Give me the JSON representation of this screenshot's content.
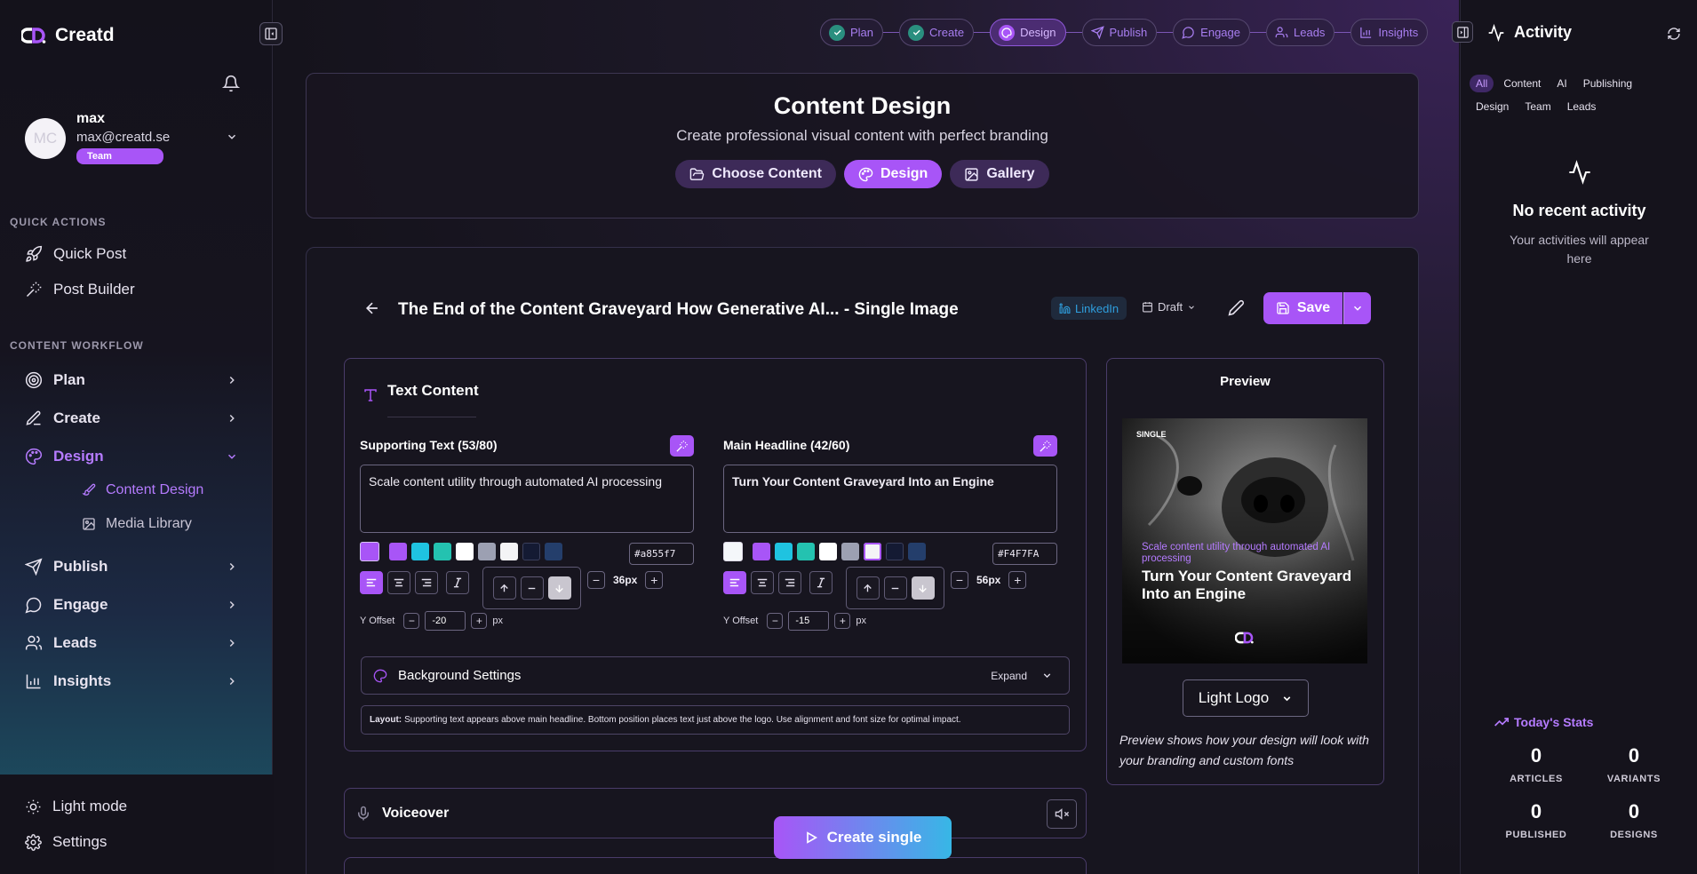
{
  "app": {
    "name": "Creatd"
  },
  "user": {
    "initials": "MC",
    "name": "max",
    "email": "max@creatd.se",
    "badge": "Team"
  },
  "sidebar": {
    "quick_actions_label": "QUICK ACTIONS",
    "quick_actions": [
      {
        "label": "Quick Post",
        "icon": "rocket-icon"
      },
      {
        "label": "Post Builder",
        "icon": "magic-wand-icon"
      }
    ],
    "workflow_label": "CONTENT WORKFLOW",
    "workflow": [
      {
        "label": "Plan",
        "icon": "target-icon"
      },
      {
        "label": "Create",
        "icon": "pen-icon"
      },
      {
        "label": "Design",
        "icon": "palette-icon",
        "expanded": true
      },
      {
        "label": "Publish",
        "icon": "send-icon"
      },
      {
        "label": "Engage",
        "icon": "chat-icon"
      },
      {
        "label": "Leads",
        "icon": "users-icon"
      },
      {
        "label": "Insights",
        "icon": "bar-chart-icon"
      }
    ],
    "design_sub": [
      {
        "label": "Content Design",
        "active": true
      },
      {
        "label": "Media Library"
      }
    ],
    "bottom": [
      {
        "label": "Light mode",
        "icon": "sun-icon"
      },
      {
        "label": "Settings",
        "icon": "gear-icon"
      }
    ]
  },
  "stepper": [
    {
      "label": "Plan",
      "state": "done"
    },
    {
      "label": "Create",
      "state": "done"
    },
    {
      "label": "Design",
      "state": "active"
    },
    {
      "label": "Publish",
      "state": "todo"
    },
    {
      "label": "Engage",
      "state": "todo"
    },
    {
      "label": "Leads",
      "state": "todo"
    },
    {
      "label": "Insights",
      "state": "todo"
    }
  ],
  "header": {
    "title": "Content Design",
    "subtitle": "Create professional visual content with perfect branding",
    "tabs": [
      {
        "label": "Choose Content"
      },
      {
        "label": "Design",
        "active": true
      },
      {
        "label": "Gallery"
      }
    ]
  },
  "editor": {
    "title": "The End of the Content Graveyard How Generative AI... - Single Image",
    "platform": "LinkedIn",
    "status": "Draft",
    "save_label": "Save",
    "text_content_title": "Text Content",
    "supporting": {
      "label": "Supporting Text (53/80)",
      "value": "Scale content utility through automated AI processing",
      "hex": "#a855f7",
      "font_size": "36px",
      "y_offset_label": "Y Offset",
      "y_offset": "-20",
      "unit": "px"
    },
    "headline": {
      "label": "Main Headline (42/60)",
      "value": "Turn Your Content Graveyard Into an Engine",
      "hex": "#F4F7FA",
      "font_size": "56px",
      "y_offset_label": "Y Offset",
      "y_offset": "-15",
      "unit": "px"
    },
    "palette": [
      "#a855f7",
      "#1fc3e0",
      "#24c2b0",
      "#ffffff",
      "#9ca0b2",
      "#f4f4f6",
      "#141a33",
      "#243e6b"
    ],
    "bg_settings_label": "Background Settings",
    "expand_label": "Expand",
    "layout_note_label": "Layout:",
    "layout_note": "Supporting text appears above main headline. Bottom position places text just above the logo. Use alignment and font size for optimal impact.",
    "voiceover_label": "Voiceover",
    "create_label": "Create single"
  },
  "preview": {
    "title": "Preview",
    "tag": "SINGLE",
    "supporting": "Scale content utility through automated AI processing",
    "headline": "Turn Your Content Graveyard Into an Engine",
    "logo": "Light Logo",
    "note": "Preview shows how your design will look with your branding and custom fonts"
  },
  "activity": {
    "title": "Activity",
    "filters": [
      {
        "label": "All",
        "active": true
      },
      {
        "label": "Content"
      },
      {
        "label": "AI"
      },
      {
        "label": "Publishing"
      },
      {
        "label": "Design"
      },
      {
        "label": "Team"
      },
      {
        "label": "Leads"
      }
    ],
    "empty_title": "No recent activity",
    "empty_text": "Your activities will appear here",
    "stats_title": "Today's Stats",
    "stats": [
      {
        "value": "0",
        "label": "ARTICLES"
      },
      {
        "value": "0",
        "label": "VARIANTS"
      },
      {
        "value": "0",
        "label": "PUBLISHED"
      },
      {
        "value": "0",
        "label": "DESIGNS"
      }
    ]
  },
  "colors": {
    "accent": "#a855f7",
    "linkedin": "#2f9fde",
    "cyan": "#37b7e6"
  }
}
